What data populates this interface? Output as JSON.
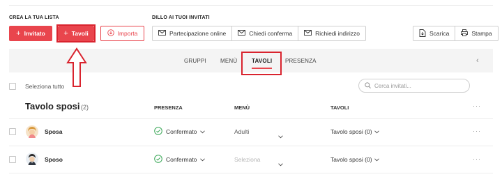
{
  "sections": {
    "create_list": "CREA LA TUA LISTA",
    "tell_guests": "DILLO AI TUOI INVITATI"
  },
  "toolbar": {
    "add_guest": "Invitato",
    "add_table": "Tavoli",
    "import": "Importa",
    "online_participation": "Partecipazione online",
    "ask_confirmation": "Chiedi conferma",
    "ask_address": "Richiedi indirizzo",
    "download": "Scarica",
    "print": "Stampa"
  },
  "tabs": [
    {
      "label": "GRUPPI"
    },
    {
      "label": "MENÙ"
    },
    {
      "label": "TAVOLI",
      "active": true
    },
    {
      "label": "PRESENZA"
    }
  ],
  "select_all": "Seleziona tutto",
  "search": {
    "placeholder": "Cerca invitati..."
  },
  "group": {
    "title": "Tavolo sposi",
    "count": "(2)",
    "columns": {
      "presence": "PRESENZA",
      "menu": "MENÙ",
      "tables": "TAVOLI"
    }
  },
  "rows": [
    {
      "name": "Sposa",
      "presence": "Confermato",
      "menu": "Adulti",
      "table": "Tavolo sposi (0)"
    },
    {
      "name": "Sposo",
      "presence": "Confermato",
      "menu": "Seleziona",
      "table": "Tavolo sposi (0)"
    }
  ],
  "colors": {
    "accent": "#e9454d",
    "confirmed": "#3aa757",
    "annotation": "#d9232e"
  }
}
